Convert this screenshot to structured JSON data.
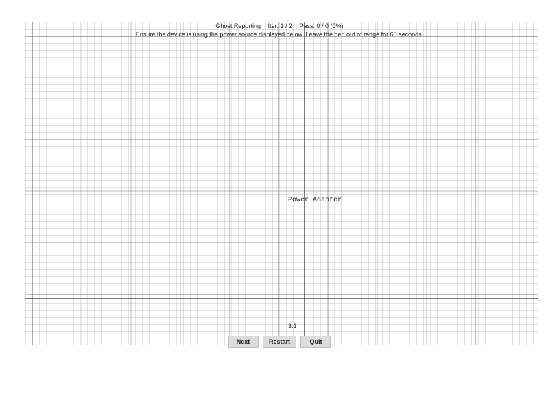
{
  "header": {
    "title": "Ghost Reporting",
    "iter_label": "Iter: 1 / 2",
    "pass_label": "Pass: 0 / 0 (0%)",
    "instruction": "Ensure the device is using the power source displayed below. Leave the pen out of range for 60 seconds."
  },
  "power_source_label": "Power Adapter",
  "timer": "3.1",
  "buttons": {
    "next": "Next",
    "restart": "Restart",
    "quit": "Quit"
  }
}
